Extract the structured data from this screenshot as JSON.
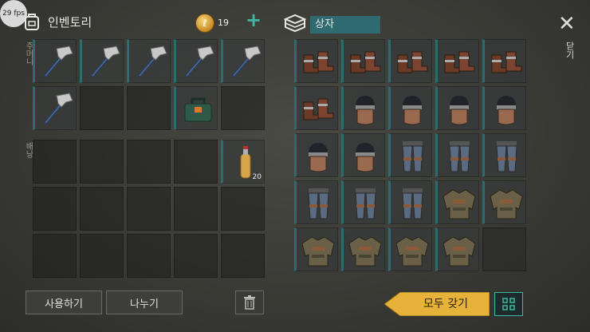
{
  "fps_text": "29 fps",
  "inventory": {
    "title": "인벤토리",
    "pockets_label": "주머니",
    "backpack_label": "배낭",
    "coins": "19",
    "pockets": [
      {
        "item": "hammer-icon"
      },
      {
        "item": "hammer-icon"
      },
      {
        "item": "hammer-icon"
      },
      {
        "item": "hammer-icon"
      },
      {
        "item": "hammer-icon"
      },
      {
        "item": "hammer-icon"
      },
      {
        "item": ""
      },
      {
        "item": ""
      },
      {
        "item": "toolbag-icon"
      },
      {
        "item": ""
      }
    ],
    "backpack": [
      {
        "item": ""
      },
      {
        "item": ""
      },
      {
        "item": ""
      },
      {
        "item": ""
      },
      {
        "item": "bottle-icon",
        "qty": "20"
      },
      {
        "item": ""
      },
      {
        "item": ""
      },
      {
        "item": ""
      },
      {
        "item": ""
      },
      {
        "item": ""
      },
      {
        "item": ""
      },
      {
        "item": ""
      },
      {
        "item": ""
      },
      {
        "item": ""
      },
      {
        "item": ""
      }
    ]
  },
  "box": {
    "title": "상자",
    "items": [
      "boots-icon",
      "boots-icon",
      "boots-icon",
      "boots-icon",
      "boots-icon",
      "boots-icon",
      "helmet-icon",
      "helmet-icon",
      "helmet-icon",
      "helmet-icon",
      "helmet-icon",
      "helmet-icon",
      "pants-icon",
      "pants-icon",
      "pants-icon",
      "pants-icon",
      "pants-icon",
      "pants-icon",
      "jacket-icon",
      "jacket-icon",
      "jacket-icon",
      "jacket-icon",
      "jacket-icon",
      "jacket-icon",
      ""
    ]
  },
  "close_label": "닫기",
  "buttons": {
    "use": "사용하기",
    "split": "나누기",
    "take_all": "모두 갖기"
  },
  "colors": {
    "accent": "#3fb8a3",
    "box_label_bg": "#2f6a70",
    "take_all": "#e6b23a"
  }
}
